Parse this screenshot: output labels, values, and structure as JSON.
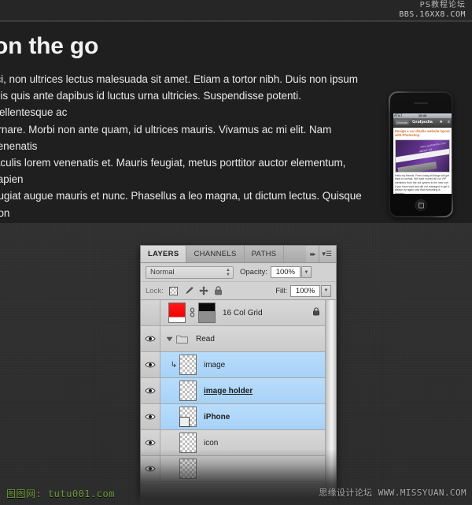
{
  "watermarks": {
    "top_line1": "PS教程论坛",
    "top_line2": "BBS.16XX8.COM",
    "bottom_left": "图图网: tutu001.com",
    "bottom_right_cn": "思缘设计论坛",
    "bottom_right_url": "WWW.MISSYUAN.COM"
  },
  "article": {
    "heading": "on the go",
    "body": "rci, non ultrices lectus malesuada sit amet. Etiam a tortor nibh. Duis non ipsum\nelis quis ante dapibus id luctus urna ultricies. Suspendisse potenti. Pellentesque ac\nornare. Morbi non ante quam, id ultrices mauris. Vivamus ac mi elit. Nam venenatis\niaculis lorem venenatis et. Mauris feugiat, metus porttitor auctor elementum, sapien\neugiat augue mauris et nunc. Phasellus a leo magna, ut dictum lectus. Quisque non\npibus lectus."
  },
  "phone": {
    "status_left": "AT&T",
    "status_time": "10:44",
    "nav_back": "Website",
    "nav_title": "Grafpedia",
    "nav_star": "★",
    "nav_more": "≡",
    "post_title": "Design a cor diseño website layout with Photoshop",
    "post_image_label_top": "www.grafpedia.com",
    "post_image_label_mid": "ABOUT US",
    "post_body": "Hello my friends. From today all things will get back to normal. We have moved all our VIP members from the old system to the new one. If you have tried and did not managed to get it, please try again now that everything is finished."
  },
  "panel": {
    "tabs": [
      {
        "label": "LAYERS",
        "active": true
      },
      {
        "label": "CHANNELS",
        "active": false
      },
      {
        "label": "PATHS",
        "active": false
      }
    ],
    "collapse_icon": "▸▸",
    "menu_icon": "▾☰",
    "blend_mode": "Normal",
    "opacity_label": "Opacity:",
    "opacity_value": "100%",
    "fill_label": "Fill:",
    "fill_value": "100%",
    "lock_label": "Lock:",
    "lock_icons": [
      "lock-transparency-icon",
      "lock-brush-icon",
      "lock-move-icon",
      "lock-all-icon"
    ],
    "layers": [
      {
        "name": "16 Col Grid",
        "visible": false,
        "selected": false,
        "type": "layer-with-mask",
        "thumb": "red",
        "linked": true,
        "mask": true,
        "locked": true,
        "indent": 0,
        "clipped": false,
        "editing": false
      },
      {
        "name": "Read",
        "visible": true,
        "selected": false,
        "type": "group",
        "expanded": true,
        "indent": 0,
        "clipped": false,
        "editing": false
      },
      {
        "name": "image",
        "visible": true,
        "selected": true,
        "type": "layer",
        "thumb": "transparent",
        "indent": 1,
        "clipped": true,
        "editing": false
      },
      {
        "name": "image holder",
        "visible": true,
        "selected": true,
        "type": "layer",
        "thumb": "transparent",
        "indent": 1,
        "clipped": false,
        "editing": true
      },
      {
        "name": "iPhone",
        "visible": true,
        "selected": true,
        "type": "smart-object",
        "thumb": "transparent",
        "indent": 1,
        "clipped": false,
        "editing": false
      },
      {
        "name": "icon",
        "visible": true,
        "selected": false,
        "type": "layer",
        "thumb": "transparent",
        "indent": 1,
        "clipped": false,
        "editing": false
      }
    ]
  },
  "colors": {
    "panel_bg": "#d4d4d4",
    "selection": "#a6d2f7",
    "article_bg": "#1f1f1f",
    "accent_red": "#f20000",
    "watermark_green": "#6f9a3a"
  }
}
